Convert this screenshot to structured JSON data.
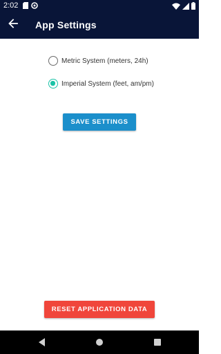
{
  "status_bar": {
    "time": "2:02",
    "left_icons": [
      "sd-card-icon",
      "sync-icon"
    ],
    "right_icons": [
      "wifi-icon",
      "signal-icon",
      "battery-icon"
    ]
  },
  "app_bar": {
    "back_icon": "arrow-back-icon",
    "title": "App Settings"
  },
  "units": {
    "options": [
      {
        "label": "Metric System (meters, 24h)",
        "selected": false
      },
      {
        "label": "Imperial System (feet, am/pm)",
        "selected": true
      }
    ]
  },
  "actions": {
    "save_label": "SAVE SETTINGS",
    "reset_label": "RESET APPLICATION DATA"
  },
  "nav_bar": {
    "icons": [
      "nav-back-icon",
      "nav-home-icon",
      "nav-recents-icon"
    ]
  },
  "colors": {
    "app_bar": "#091538",
    "accent_radio": "#19c2a6",
    "save_button": "#1b8fcb",
    "reset_button": "#f0463b"
  }
}
